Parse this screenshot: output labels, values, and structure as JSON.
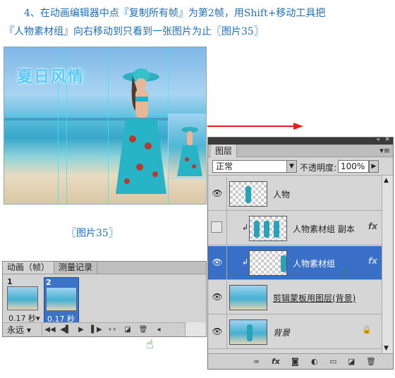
{
  "instruction": {
    "line1": "4、在动画编辑器中点『复制所有帧』为第2帧，用Shift+移动工具把",
    "line2": "『人物素材组』向右移动到只看到一张图片为止〖图片35〗"
  },
  "photo": {
    "title_art": "夏日风情"
  },
  "caption": "〖图片35〗",
  "animation_panel": {
    "tabs": [
      {
        "label": "动画（帧）",
        "active": true
      },
      {
        "label": "测量记录",
        "active": false
      }
    ],
    "frames": [
      {
        "number": "1",
        "delay": "0.17 秒▾",
        "selected": false
      },
      {
        "number": "2",
        "delay": "0.17 秒▾",
        "selected": true
      }
    ],
    "loop": "永远 ▾",
    "toolbar_icons": [
      "first-frame-icon",
      "prev-frame-icon",
      "play-icon",
      "next-frame-icon",
      "tween-icon",
      "duplicate-frame-icon",
      "delete-frame-icon"
    ]
  },
  "layers_panel": {
    "title": "图层",
    "blend_mode": "正常",
    "opacity_label": "不透明度:",
    "opacity_value": "100%",
    "layers": [
      {
        "name": "人物",
        "visible": true,
        "selected": false
      },
      {
        "name": "人物素材组 副本",
        "visible": false,
        "selected": false
      },
      {
        "name": "人物素材组",
        "visible": true,
        "selected": true
      },
      {
        "name": "剪辑蒙板用图层(背景)",
        "visible": true,
        "selected": false
      },
      {
        "name": "背景",
        "visible": true,
        "selected": false
      }
    ],
    "fx_label": "fx"
  },
  "colors": {
    "instruction_text": "#1f6fb8",
    "selection": "#3a6fc8",
    "arrow": "#e12020",
    "guides": "#39e1ff"
  }
}
